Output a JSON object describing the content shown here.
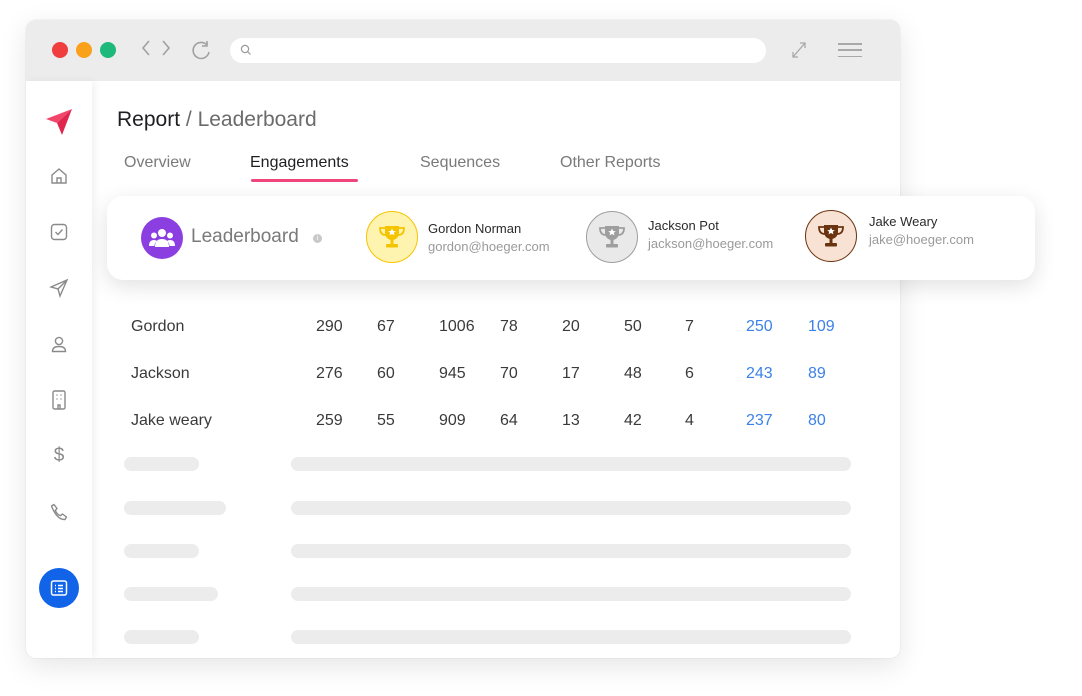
{
  "browser": {
    "dots": [
      "#f03e3e",
      "#f9a11b",
      "#1db97b"
    ],
    "search_icon": "search-icon"
  },
  "breadcrumb": {
    "root": "Report",
    "separator": "/",
    "page": "Leaderboard"
  },
  "tabs": [
    {
      "label": "Overview"
    },
    {
      "label": "Engagements",
      "active": true
    },
    {
      "label": "Sequences"
    },
    {
      "label": "Other Reports"
    }
  ],
  "sidebar": {
    "items": [
      {
        "icon": "paper-plane-logo-icon"
      },
      {
        "icon": "home-icon"
      },
      {
        "icon": "checkbox-icon"
      },
      {
        "icon": "send-icon"
      },
      {
        "icon": "user-icon"
      },
      {
        "icon": "building-icon"
      },
      {
        "icon": "dollar-icon"
      },
      {
        "icon": "phone-icon"
      },
      {
        "icon": "list-icon",
        "active": true
      }
    ]
  },
  "leaderboard": {
    "title": "Leaderboard",
    "entries": [
      {
        "name": "Gordon Norman",
        "email": "gordon@hoeger.com",
        "medal": "gold",
        "color": "#f5c400"
      },
      {
        "name": "Jackson Pot",
        "email": "jackson@hoeger.com",
        "medal": "silver",
        "color": "#9e9e9e"
      },
      {
        "name": "Jake Weary",
        "email": "jake@hoeger.com",
        "medal": "bronze",
        "color": "#6b3410"
      }
    ]
  },
  "table": {
    "rows": [
      {
        "name": "Gordon",
        "values": [
          "290",
          "67",
          "1006",
          "78",
          "20",
          "50",
          "7",
          "250",
          "109"
        ]
      },
      {
        "name": "Jackson",
        "values": [
          "276",
          "60",
          "945",
          "70",
          "17",
          "48",
          "6",
          "243",
          "89"
        ]
      },
      {
        "name": "Jake weary",
        "values": [
          "259",
          "55",
          "909",
          "64",
          "13",
          "42",
          "4",
          "237",
          "80"
        ]
      }
    ]
  },
  "colors": {
    "accent": "#f0457b",
    "primary": "#1163e8",
    "link": "#3b82e8"
  }
}
